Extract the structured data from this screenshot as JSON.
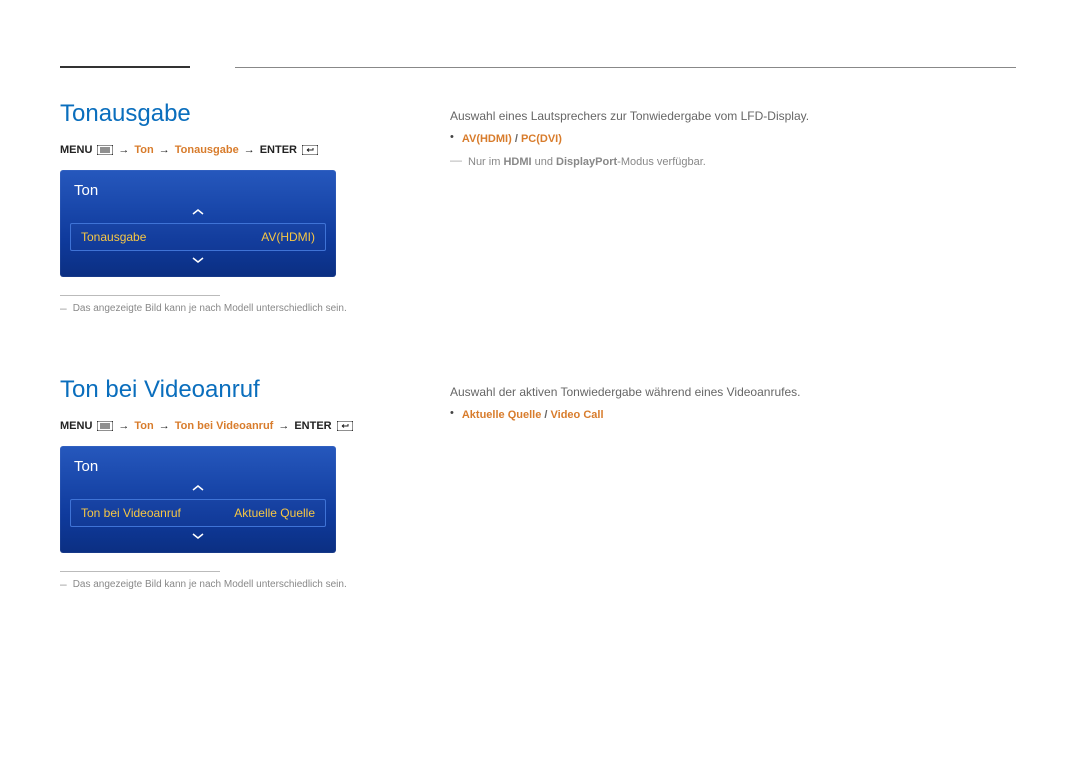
{
  "section1": {
    "title": "Tonausgabe",
    "crumb": {
      "menu": "MENU",
      "c1": "Ton",
      "c2": "Tonausgabe",
      "enter": "ENTER"
    },
    "osd": {
      "header": "Ton",
      "label": "Tonausgabe",
      "value": "AV(HDMI)"
    },
    "footnote": "Das angezeigte Bild kann je nach Modell unterschiedlich sein.",
    "desc": "Auswahl eines Lautsprechers zur Tonwiedergabe vom LFD-Display.",
    "option_a": "AV(HDMI)",
    "option_b": "PC(DVI)",
    "option_sep": " / ",
    "hint_pre": "Nur im ",
    "hint_b1": "HDMI",
    "hint_mid": " und ",
    "hint_b2": "DisplayPort",
    "hint_post": "-Modus verfügbar."
  },
  "section2": {
    "title": "Ton bei Videoanruf",
    "crumb": {
      "menu": "MENU",
      "c1": "Ton",
      "c2": "Ton bei Videoanruf",
      "enter": "ENTER"
    },
    "osd": {
      "header": "Ton",
      "label": "Ton bei Videoanruf",
      "value": "Aktuelle Quelle"
    },
    "footnote": "Das angezeigte Bild kann je nach Modell unterschiedlich sein.",
    "desc": "Auswahl der aktiven Tonwiedergabe während eines Videoanrufes.",
    "option_a": "Aktuelle Quelle",
    "option_b": "Video Call",
    "option_sep": " / "
  }
}
